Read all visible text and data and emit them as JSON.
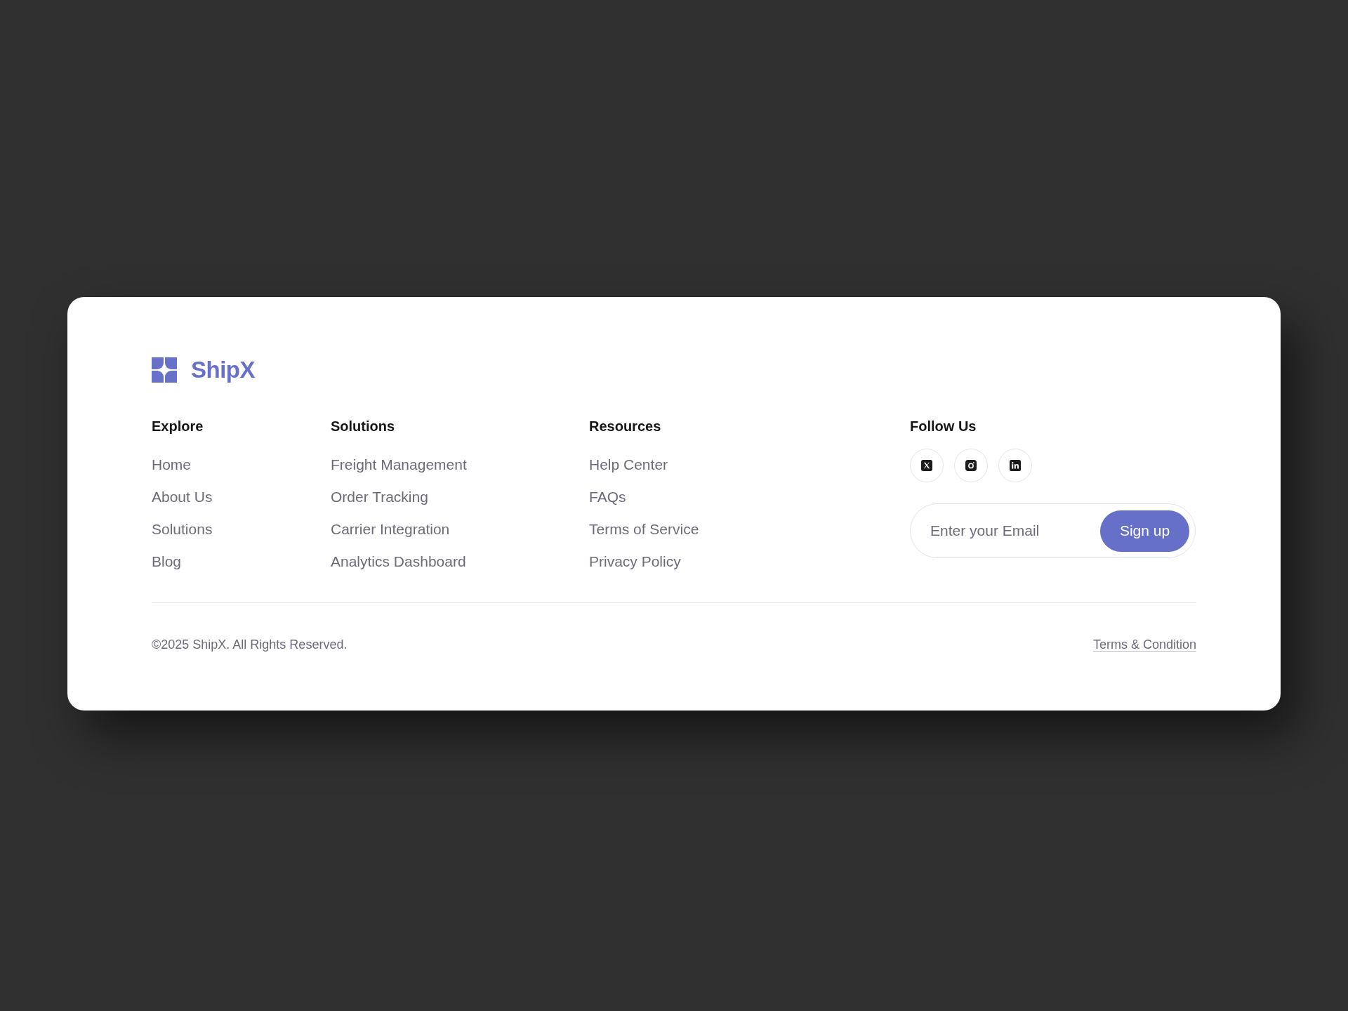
{
  "brand": {
    "name": "ShipX"
  },
  "columns": [
    {
      "heading": "Explore",
      "links": [
        "Home",
        "About Us",
        "Solutions",
        "Blog"
      ]
    },
    {
      "heading": "Solutions",
      "links": [
        "Freight Management",
        "Order Tracking",
        "Carrier Integration",
        "Analytics Dashboard"
      ]
    },
    {
      "heading": "Resources",
      "links": [
        "Help Center",
        "FAQs",
        "Terms of Service",
        "Privacy Policy"
      ]
    }
  ],
  "follow": {
    "heading": "Follow Us",
    "newsletter": {
      "placeholder": "Enter your Email",
      "button": "Sign up"
    }
  },
  "bottom_bar": {
    "copyright": "©2025 ShipX. All Rights Reserved.",
    "link": "Terms & Condition"
  }
}
